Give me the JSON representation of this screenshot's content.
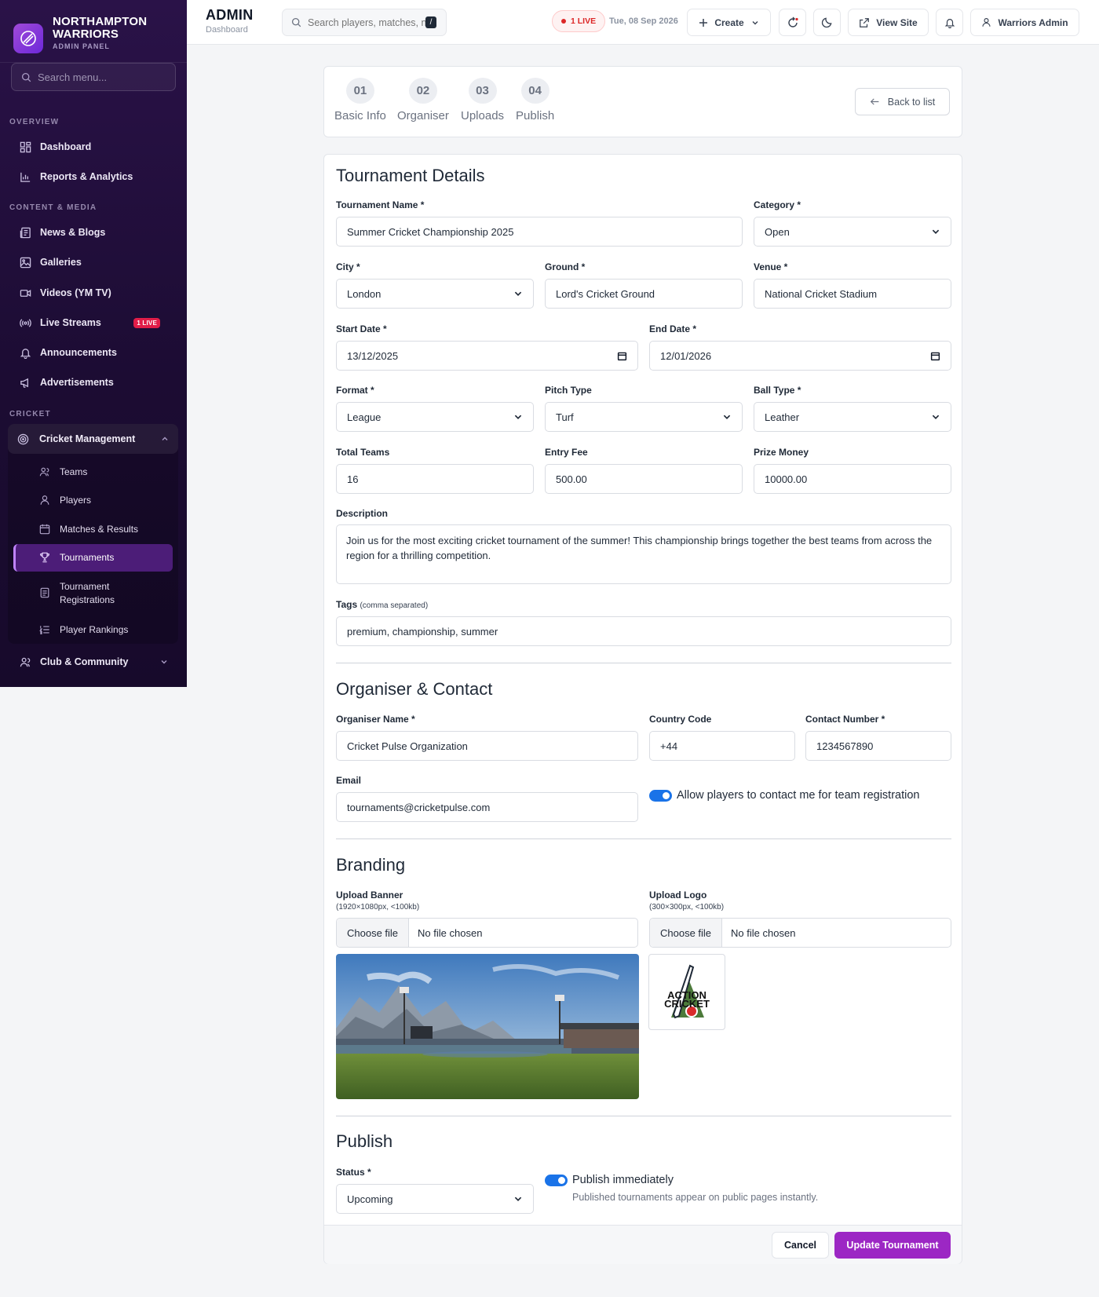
{
  "brand": {
    "name_line1": "NORTHAMPTON",
    "name_line2": "WARRIORS",
    "subtitle": "ADMIN PANEL"
  },
  "sidebar": {
    "search_placeholder": "Search menu...",
    "sections": {
      "overview": "OVERVIEW",
      "content": "CONTENT & MEDIA",
      "cricket": "CRICKET"
    },
    "items": {
      "dashboard": "Dashboard",
      "reports": "Reports & Analytics",
      "news": "News & Blogs",
      "galleries": "Galleries",
      "videos": "Videos (YM TV)",
      "live_streams": "Live Streams",
      "live_badge": "1 LIVE",
      "announcements": "Announcements",
      "advertisements": "Advertisements",
      "cricket_management": "Cricket Management",
      "club": "Club & Community"
    },
    "cricket_sub": {
      "teams": "Teams",
      "players": "Players",
      "matches": "Matches & Results",
      "tournaments": "Tournaments",
      "registrations_line1": "Tournament",
      "registrations_line2": "Registrations",
      "rankings": "Player Rankings"
    }
  },
  "topbar": {
    "title": "ADMIN",
    "subtitle": "Dashboard",
    "search_placeholder": "Search players, matches, n",
    "search_kbd": "/",
    "live": "1 LIVE",
    "date": "Tue, 08 Sep 2026",
    "create": "Create",
    "view_site": "View Site",
    "user": "Warriors Admin"
  },
  "stepper": {
    "steps": [
      {
        "num": "01",
        "label": "Basic Info"
      },
      {
        "num": "02",
        "label": "Organiser"
      },
      {
        "num": "03",
        "label": "Uploads"
      },
      {
        "num": "04",
        "label": "Publish"
      }
    ],
    "back": "Back to list"
  },
  "details": {
    "heading": "Tournament Details",
    "name_label": "Tournament Name *",
    "name_value": "Summer Cricket Championship 2025",
    "category_label": "Category *",
    "category_value": "Open",
    "city_label": "City *",
    "city_value": "London",
    "ground_label": "Ground *",
    "ground_value": "Lord's Cricket Ground",
    "venue_label": "Venue *",
    "venue_value": "National Cricket Stadium",
    "start_label": "Start Date *",
    "start_value": "13/12/2025",
    "end_label": "End Date *",
    "end_value": "12/01/2026",
    "format_label": "Format *",
    "format_value": "League",
    "pitch_label": "Pitch Type",
    "pitch_value": "Turf",
    "ball_label": "Ball Type *",
    "ball_value": "Leather",
    "teams_label": "Total Teams",
    "teams_value": "16",
    "fee_label": "Entry Fee",
    "fee_value": "500.00",
    "prize_label": "Prize Money",
    "prize_value": "10000.00",
    "desc_label": "Description",
    "desc_value": "Join us for the most exciting cricket tournament of the summer! This championship brings together the best teams from across the region for a thrilling competition.",
    "tags_label": "Tags",
    "tags_hint": "(comma separated)",
    "tags_value": "premium, championship, summer"
  },
  "organiser": {
    "heading": "Organiser & Contact",
    "name_label": "Organiser Name *",
    "name_value": "Cricket Pulse Organization",
    "code_label": "Country Code",
    "code_value": "+44",
    "contact_label": "Contact Number *",
    "contact_value": "1234567890",
    "email_label": "Email",
    "email_value": "tournaments@cricketpulse.com",
    "allow_contact": "Allow players to contact me for team registration"
  },
  "branding": {
    "heading": "Branding",
    "banner_label": "Upload Banner",
    "banner_hint": "(1920×1080px, <100kb)",
    "logo_label": "Upload Logo",
    "logo_hint": "(300×300px, <100kb)",
    "choose": "Choose file",
    "no_file": "No file chosen",
    "logo_text_1": "ACTION",
    "logo_text_2": "CRICKET"
  },
  "publish": {
    "heading": "Publish",
    "status_label": "Status *",
    "status_value": "Upcoming",
    "publish_now": "Publish immediately",
    "publish_hint": "Published tournaments appear on public pages instantly."
  },
  "footer": {
    "cancel": "Cancel",
    "submit": "Update Tournament"
  },
  "colors": {
    "accent": "#9c27c4",
    "sidebar": "#1c0c33",
    "toggle": "#1a73e8",
    "live": "#dc2626"
  }
}
